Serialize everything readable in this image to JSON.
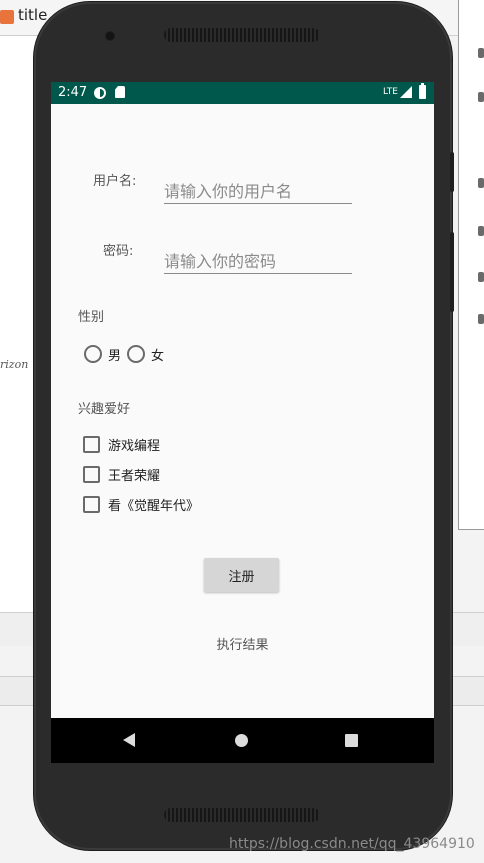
{
  "ide": {
    "tab_title": "title",
    "left_fragment": "rizon"
  },
  "status_bar": {
    "time": "2:47",
    "network": "LTE"
  },
  "form": {
    "username_label": "用户名:",
    "username_placeholder": "请输入你的用户名",
    "password_label": "密码:",
    "password_placeholder": "请输入你的密码",
    "gender_label": "性别",
    "gender_options": [
      "男",
      "女"
    ],
    "hobby_label": "兴趣爱好",
    "hobby_options": [
      "游戏编程",
      "王者荣耀",
      "看《觉醒年代》"
    ],
    "register_button": "注册",
    "result_text": "执行结果"
  },
  "watermark": "https://blog.csdn.net/qq_43964910",
  "colors": {
    "status_bar": "#00574b",
    "screen_background": "#fafafa",
    "button": "#d6d6d6"
  }
}
